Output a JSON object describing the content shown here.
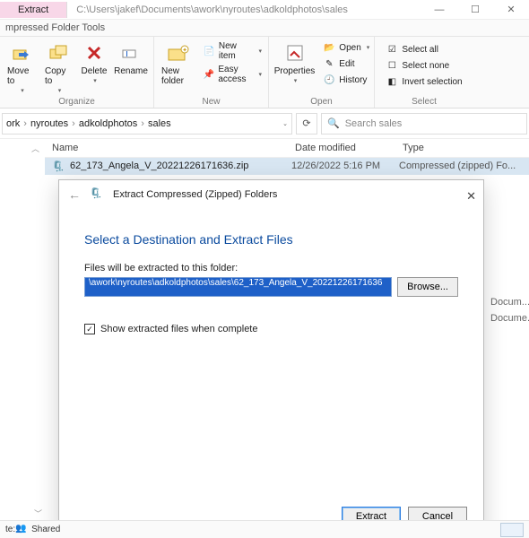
{
  "window": {
    "tab": "Extract",
    "path": "C:\\Users\\jakef\\Documents\\awork\\nyroutes\\adkoldphotos\\sales",
    "subtitle": "mpressed Folder Tools"
  },
  "ribbon": {
    "move": "Move to",
    "copy": "Copy to",
    "delete": "Delete",
    "rename": "Rename",
    "organize": "Organize",
    "newfolder": "New folder",
    "newitem": "New item",
    "easyaccess": "Easy access",
    "new": "New",
    "properties": "Properties",
    "open": "Open",
    "edit": "Edit",
    "history": "History",
    "opengrp": "Open",
    "selectall": "Select all",
    "selectnone": "Select none",
    "invert": "Invert selection",
    "select": "Select"
  },
  "breadcrumbs": [
    "ork",
    "nyroutes",
    "adkoldphotos",
    "sales"
  ],
  "search_placeholder": "Search sales",
  "columns": {
    "name": "Name",
    "date": "Date modified",
    "type": "Type"
  },
  "rows": [
    {
      "name": "62_173_Angela_V_20221226171636.zip",
      "date": "12/26/2022 5:16 PM",
      "type": "Compressed (zipped) Fo..."
    }
  ],
  "peek": {
    "a": "Docum...",
    "b": "Docume..."
  },
  "dialog": {
    "title": "Extract Compressed (Zipped) Folders",
    "heading": "Select a Destination and Extract Files",
    "label": "Files will be extracted to this folder:",
    "path": "\\awork\\nyroutes\\adkoldphotos\\sales\\62_173_Angela_V_20221226171636",
    "browse": "Browse...",
    "showfiles": "Show extracted files when complete",
    "extract": "Extract",
    "cancel": "Cancel"
  },
  "status": {
    "shared": "Shared"
  }
}
